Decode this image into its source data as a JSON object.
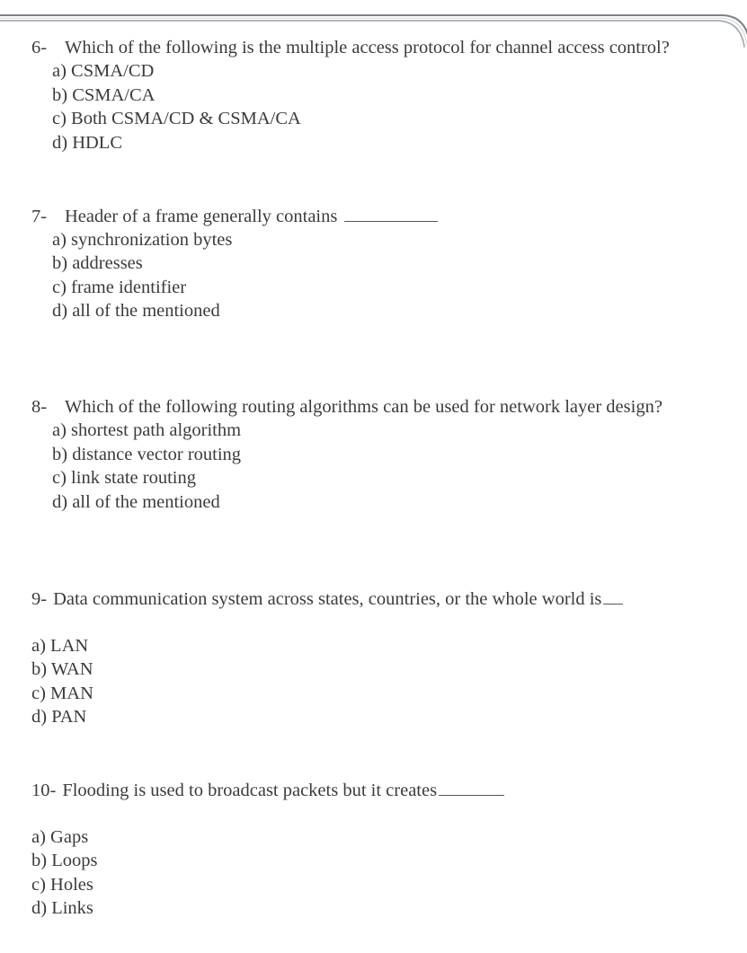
{
  "document": {
    "page_background": "#ffffff",
    "text_color": "#3b3b3b",
    "edge_color": "#8e9094"
  },
  "questions": [
    {
      "number": "6-",
      "text": "Which of the following is the multiple access protocol for channel access control?",
      "blank": null,
      "options_indented": true,
      "options": [
        "a) CSMA/CD",
        "b) CSMA/CA",
        "c) Both CSMA/CD & CSMA/CA",
        "d) HDLC"
      ]
    },
    {
      "number": "7-",
      "text": "Header of a frame generally contains",
      "blank": "__________",
      "options_indented": true,
      "options": [
        "a) synchronization bytes",
        "b) addresses",
        "c) frame identifier",
        "d) all of the mentioned"
      ]
    },
    {
      "number": "8-",
      "text": "Which of the following routing algorithms can be used for network layer design?",
      "blank": null,
      "options_indented": true,
      "options": [
        "a) shortest path algorithm",
        "b) distance vector routing",
        "c) link state routing",
        "d) all of the mentioned"
      ]
    },
    {
      "number": "9-",
      "text": "Data communication system across states, countries, or the whole world is",
      "blank": "__",
      "options_indented": false,
      "options": [
        "a) LAN",
        "b) WAN",
        "c) MAN",
        "d) PAN"
      ]
    },
    {
      "number": "10-",
      "text": "Flooding is used to broadcast packets but it creates",
      "blank": "________",
      "options_indented": false,
      "options": [
        "a) Gaps",
        "b) Loops",
        "c) Holes",
        "d) Links"
      ]
    }
  ]
}
